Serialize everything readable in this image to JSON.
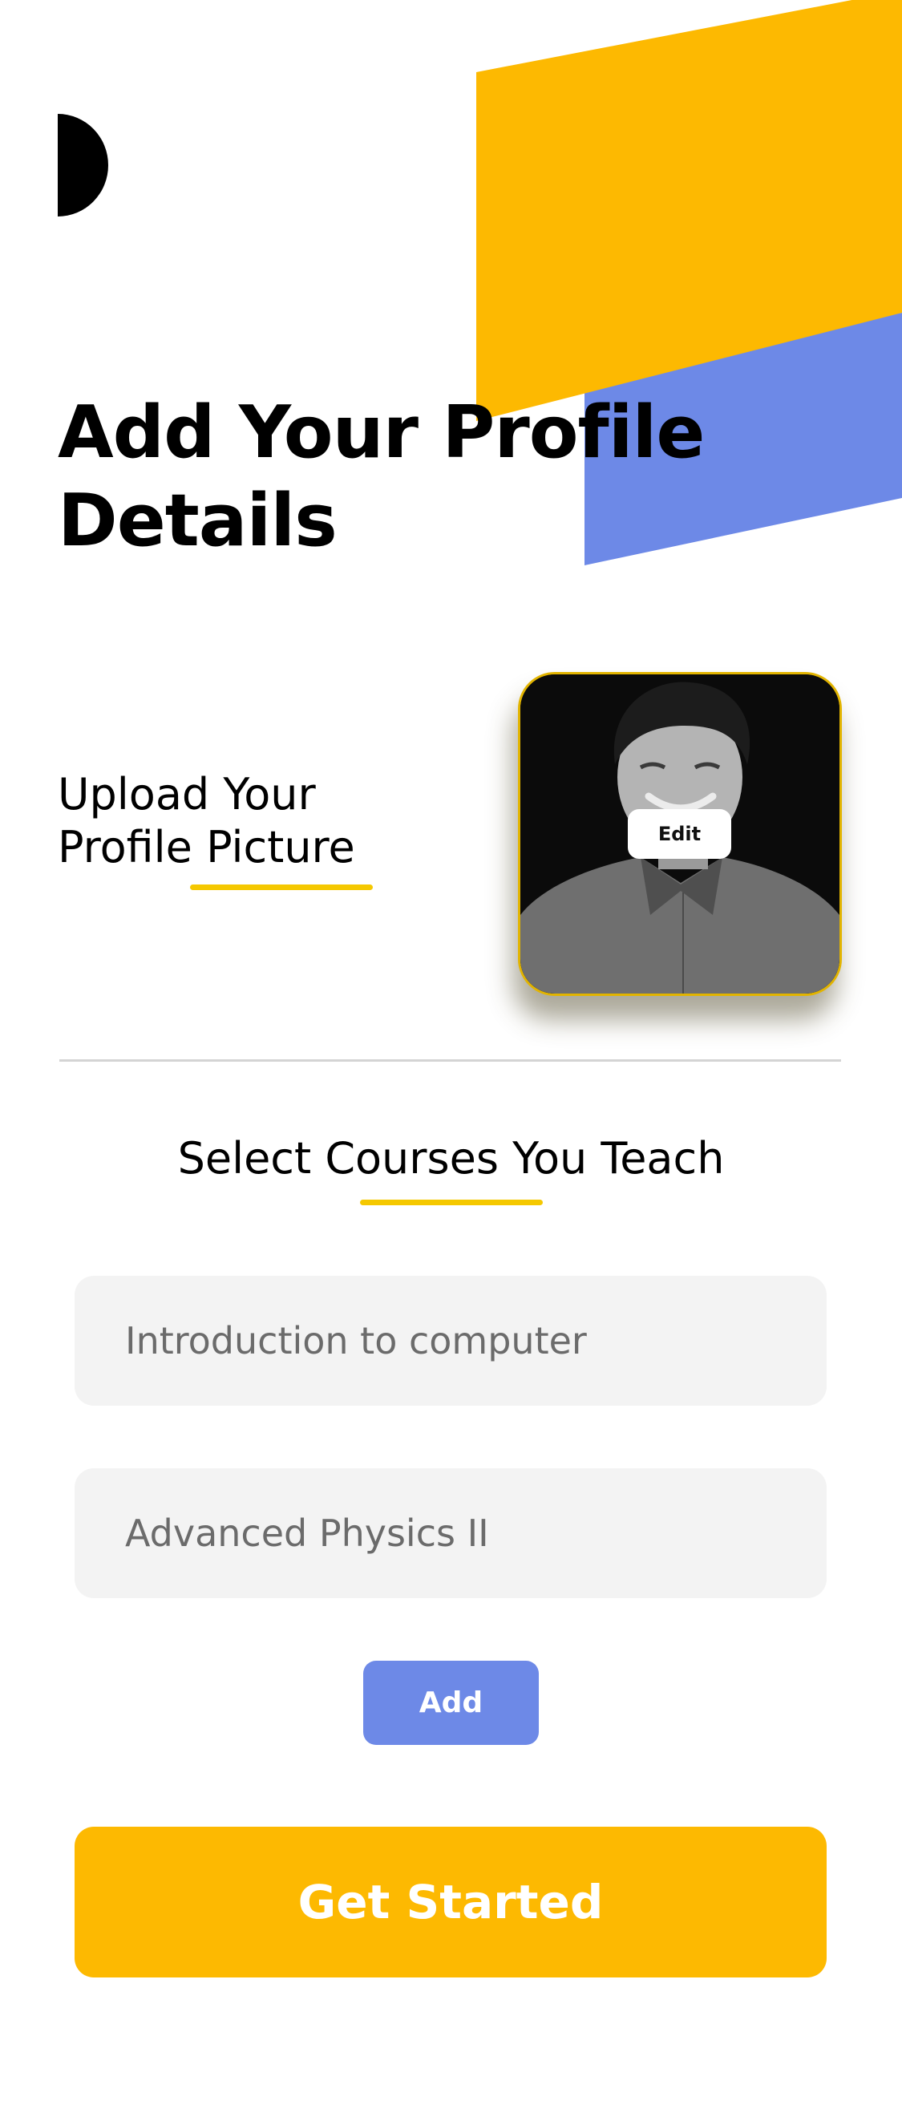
{
  "colors": {
    "accent_yellow": "#FDB901",
    "accent_blue": "#6D89E7",
    "underline_yellow": "#F5C800",
    "field_background": "#F3F3F3",
    "placeholder_text": "#6B6B6B",
    "divider": "#D4D4D4"
  },
  "header": {
    "logo_icon": "half-circle-logo-icon",
    "title": "Add Your Profile Details"
  },
  "profile_picture": {
    "label": "Upload Your Profile Picture",
    "edit_label": "Edit"
  },
  "courses": {
    "title": "Select Courses You Teach",
    "fields": [
      {
        "placeholder": "Introduction to computer"
      },
      {
        "placeholder": "Advanced Physics II"
      }
    ],
    "add_label": "Add"
  },
  "primary_action": {
    "label": "Get Started"
  }
}
